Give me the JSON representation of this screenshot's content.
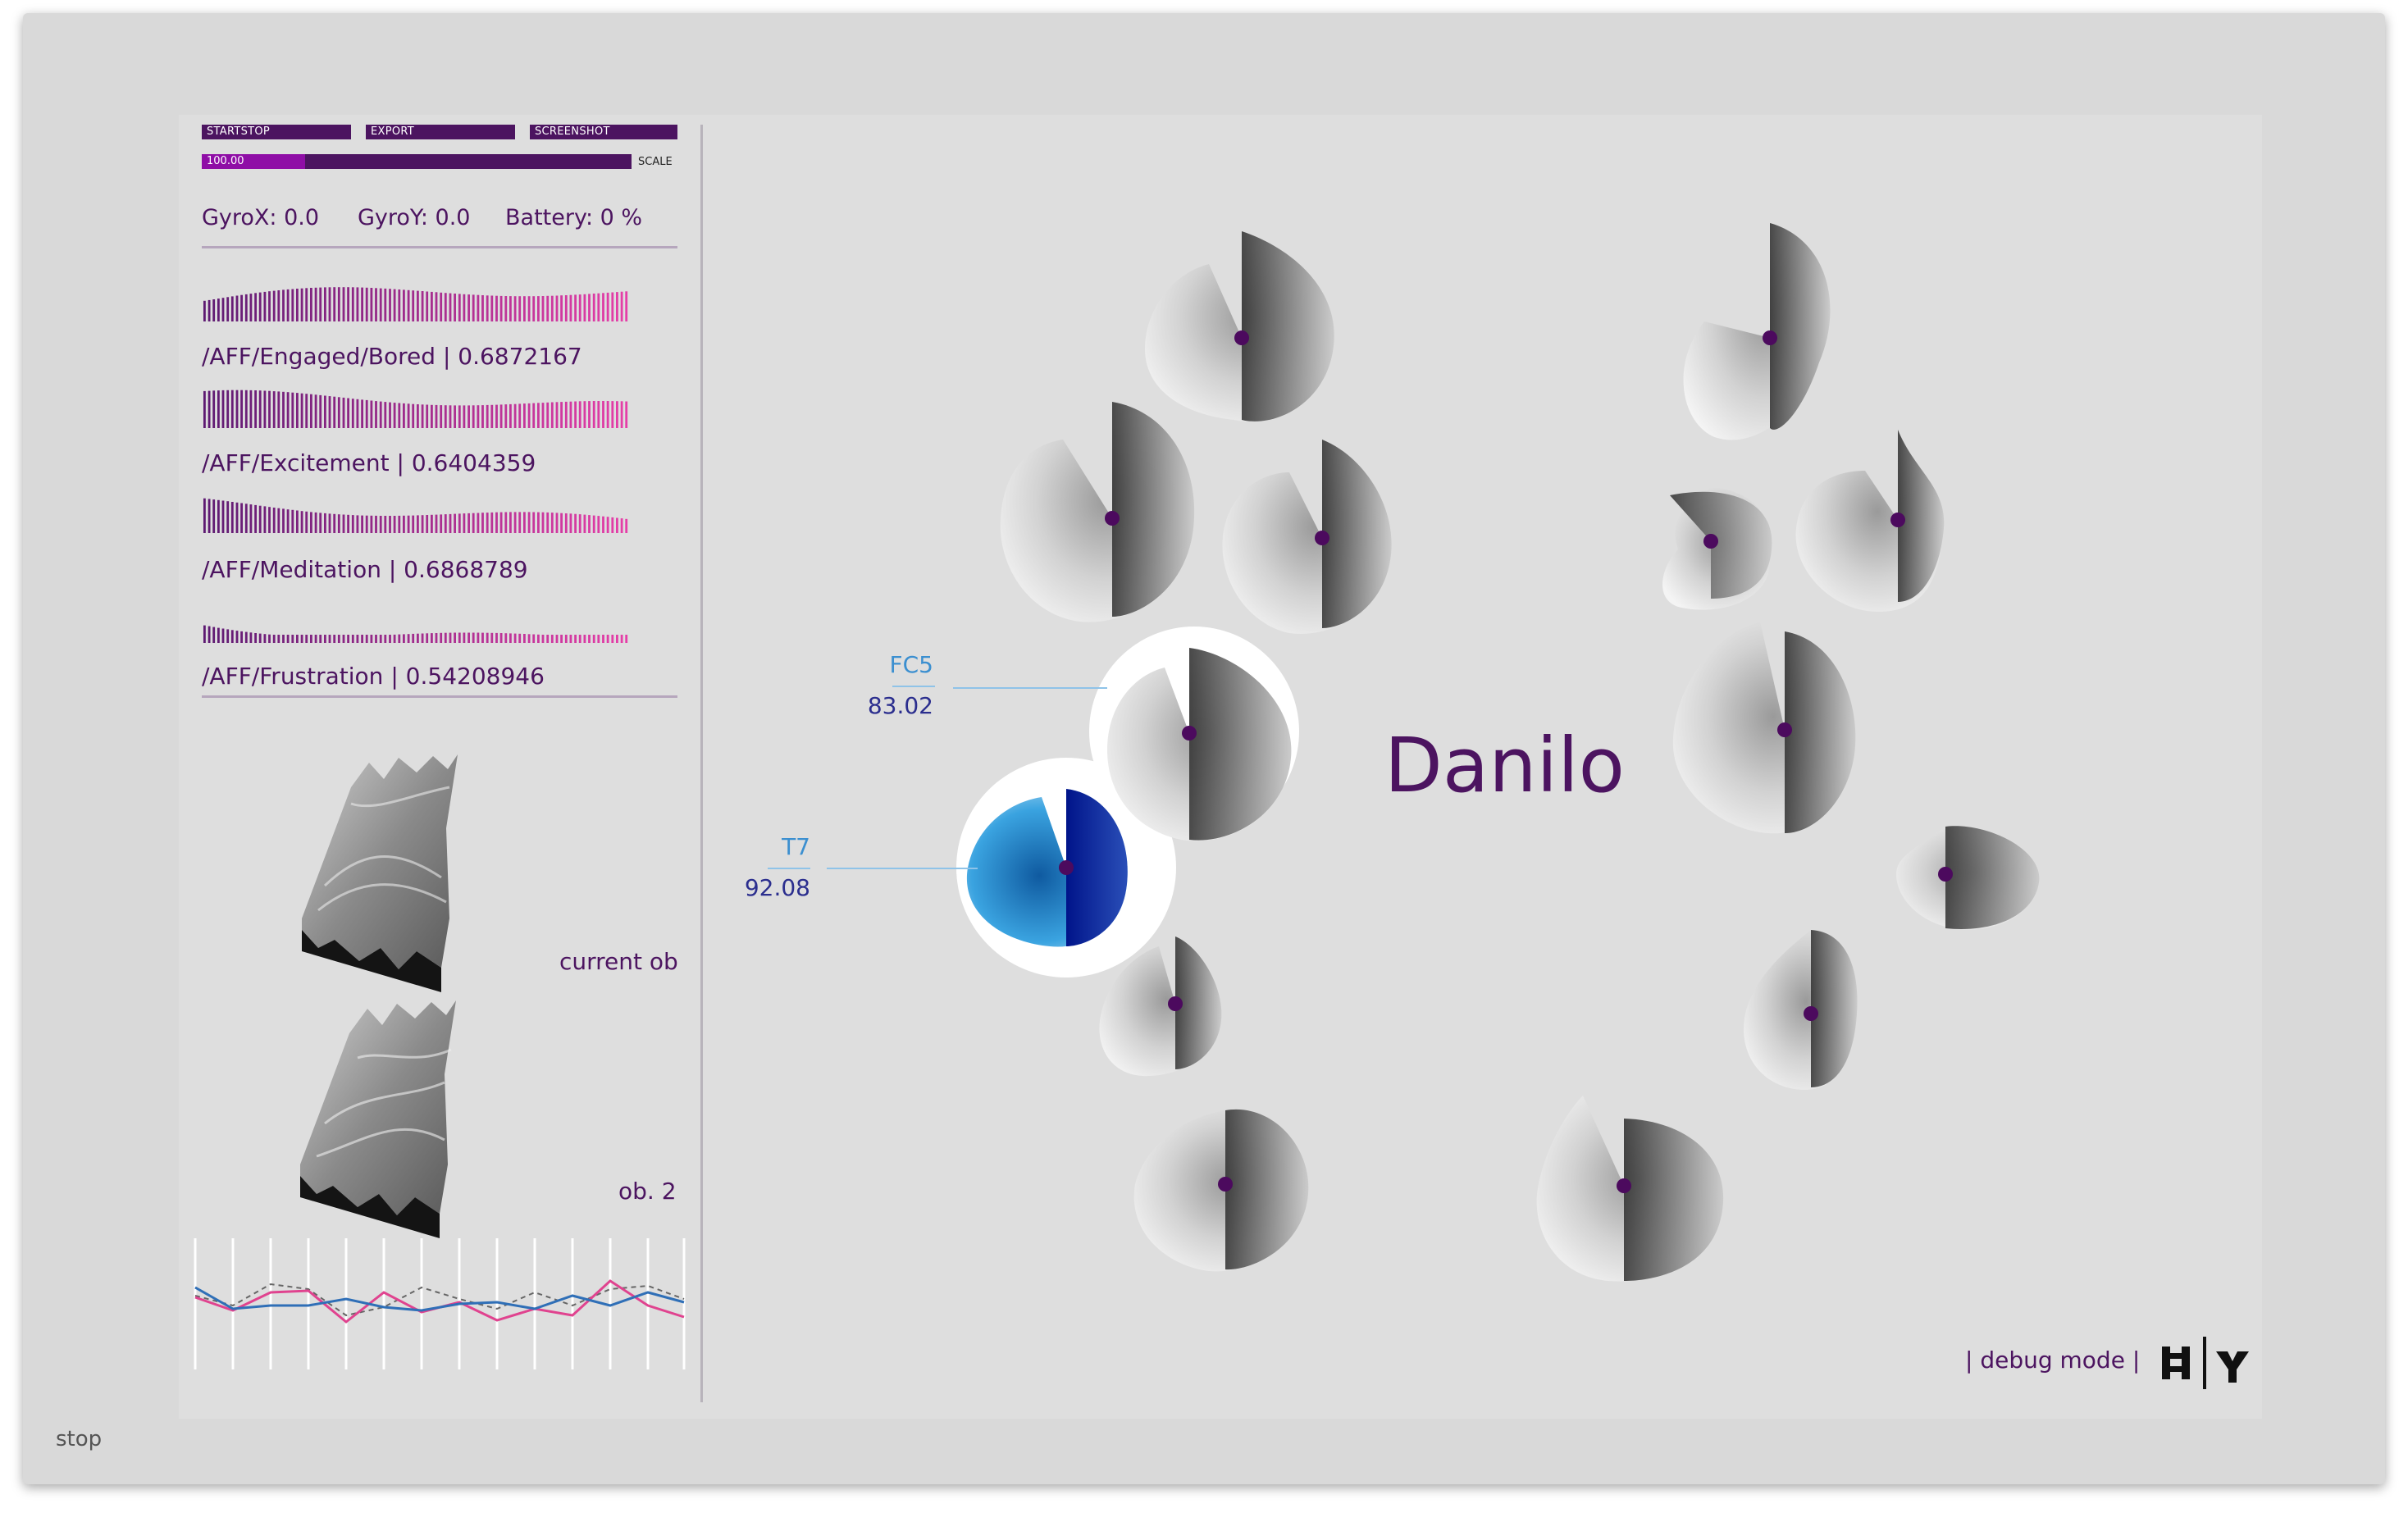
{
  "toolbar": {
    "startstop": "STARTSTOP",
    "export": "EXPORT",
    "screenshot": "SCREENSHOT"
  },
  "scale": {
    "value": "100.00",
    "label": "SCALE",
    "fill_fraction": 0.24
  },
  "sensors": {
    "gyrox": "GyroX: 0.0",
    "gyroy": "GyroY: 0.0",
    "battery": "Battery: 0 %"
  },
  "affective": [
    {
      "label": "/AFF/Engaged/Bored | 0.6872167"
    },
    {
      "label": "/AFF/Excitement | 0.6404359"
    },
    {
      "label": "/AFF/Meditation | 0.6868789"
    },
    {
      "label": "/AFF/Frustration | 0.54208946"
    }
  ],
  "models": {
    "current": "current ob",
    "second": "ob. 2"
  },
  "main": {
    "title": "Danilo"
  },
  "channels": [
    {
      "name": "FC5",
      "value": "83.02"
    },
    {
      "name": "T7",
      "value": "92.08"
    }
  ],
  "footer": {
    "debug": "| debug mode |",
    "status": "stop"
  },
  "colors": {
    "accent": "#4c1460",
    "bar_start": "#5e1a72",
    "bar_end": "#e53ea8",
    "highlight_blue": "#1f6fc0"
  }
}
